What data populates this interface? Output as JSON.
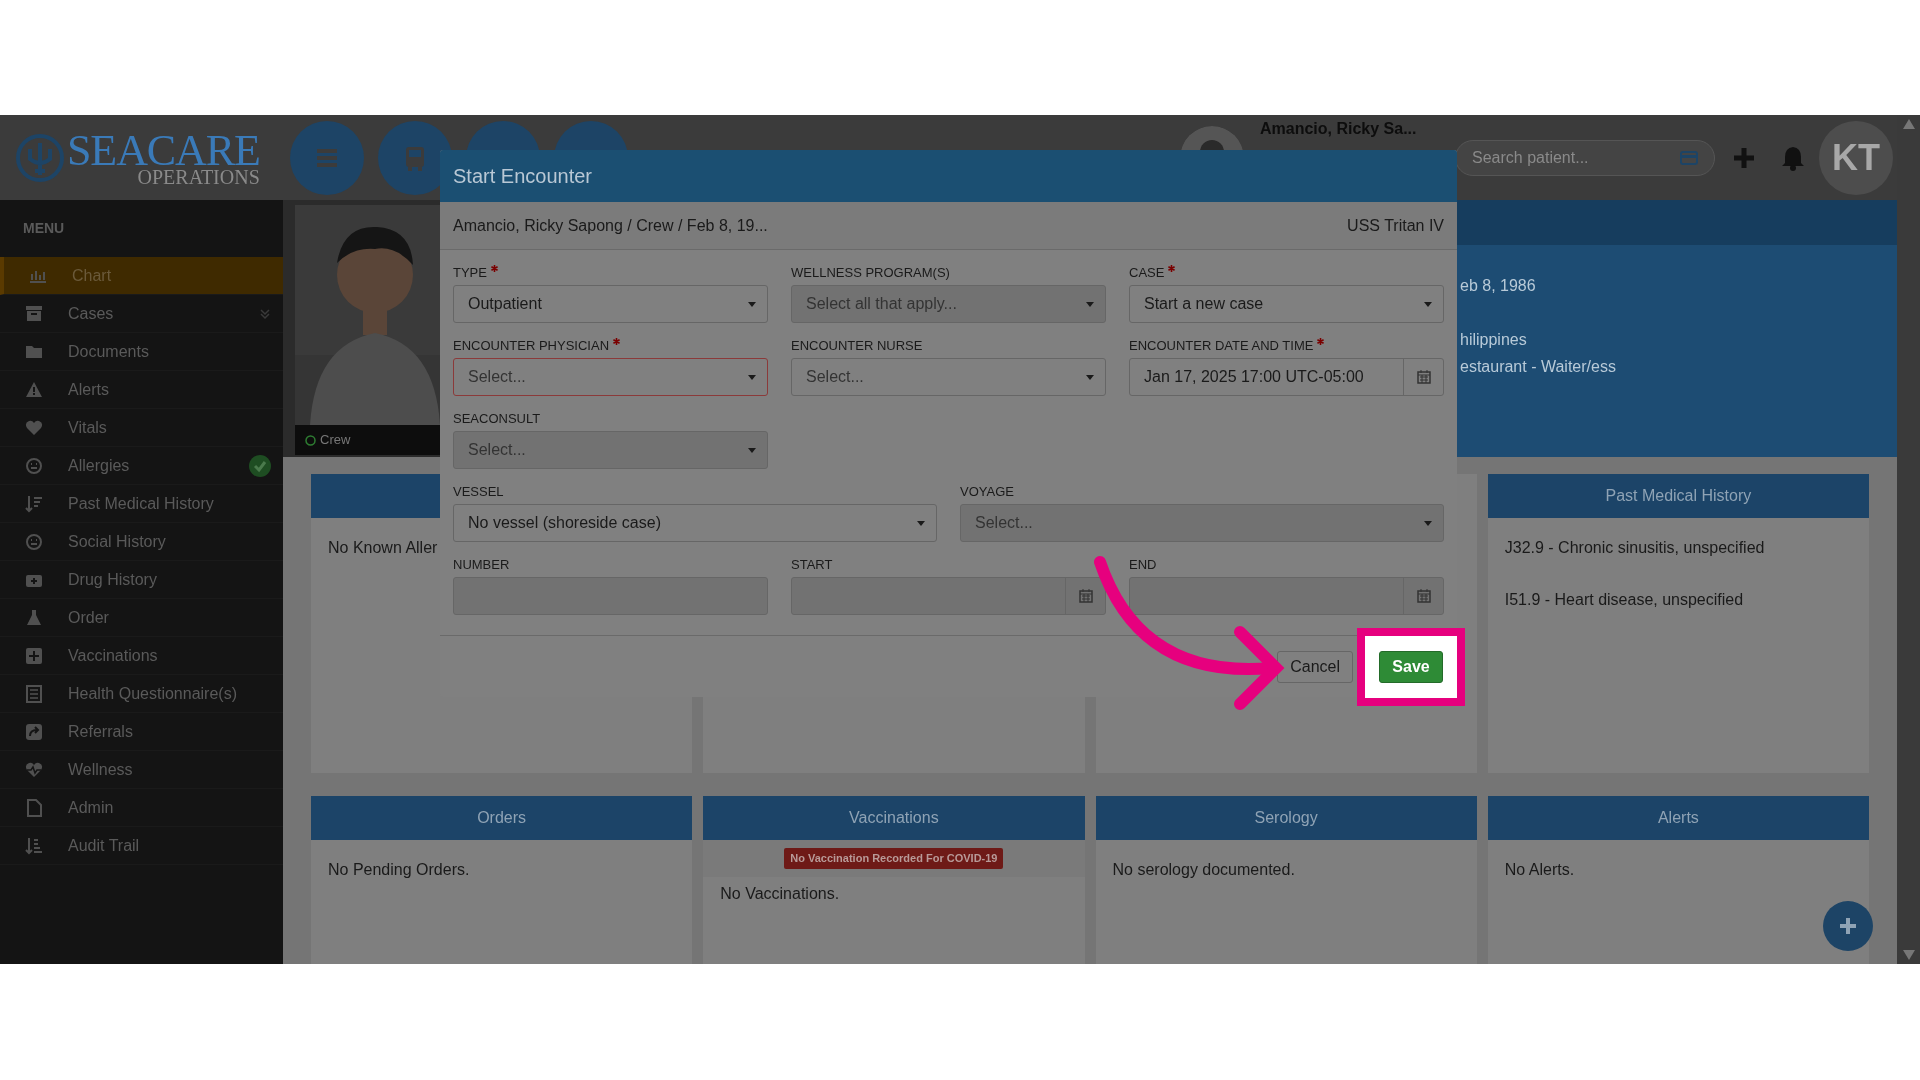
{
  "header": {
    "logo": {
      "name": "SEACARE",
      "sub": "OPERATIONS"
    },
    "patient": {
      "name": "Amancio, Ricky Sa..."
    },
    "search": {
      "placeholder": "Search patient..."
    },
    "user": {
      "initials": "KT"
    }
  },
  "sidebar": {
    "title": "MENU",
    "items": [
      {
        "label": "Chart",
        "selected": true,
        "expandable": false,
        "checked": false
      },
      {
        "label": "Cases",
        "selected": false,
        "expandable": true,
        "checked": false
      },
      {
        "label": "Documents",
        "selected": false,
        "expandable": false,
        "checked": false
      },
      {
        "label": "Alerts",
        "selected": false,
        "expandable": false,
        "checked": false
      },
      {
        "label": "Vitals",
        "selected": false,
        "expandable": false,
        "checked": false
      },
      {
        "label": "Allergies",
        "selected": false,
        "expandable": false,
        "checked": true
      },
      {
        "label": "Past Medical History",
        "selected": false,
        "expandable": false,
        "checked": false
      },
      {
        "label": "Social History",
        "selected": false,
        "expandable": false,
        "checked": false
      },
      {
        "label": "Drug History",
        "selected": false,
        "expandable": false,
        "checked": false
      },
      {
        "label": "Order",
        "selected": false,
        "expandable": false,
        "checked": false
      },
      {
        "label": "Vaccinations",
        "selected": false,
        "expandable": false,
        "checked": false
      },
      {
        "label": "Health Questionnaire(s)",
        "selected": false,
        "expandable": false,
        "checked": false
      },
      {
        "label": "Referrals",
        "selected": false,
        "expandable": false,
        "checked": false
      },
      {
        "label": "Wellness",
        "selected": false,
        "expandable": false,
        "checked": false
      },
      {
        "label": "Admin",
        "selected": false,
        "expandable": false,
        "checked": false
      },
      {
        "label": "Audit Trail",
        "selected": false,
        "expandable": false,
        "checked": false
      }
    ]
  },
  "profile": {
    "status": "Crew",
    "details": [
      "eb 8, 1986",
      "hilippines",
      "estaurant - Waiter/ess"
    ]
  },
  "top_cards": [
    {
      "lines": [
        "No Known Aller"
      ]
    },
    {
      "title": "Past Medical History",
      "lines": [
        "J32.9 - Chronic sinusitis, unspecified",
        "I51.9 - Heart disease, unspecified"
      ]
    }
  ],
  "bottom_cards": [
    {
      "title": "Orders",
      "lines": [
        "No Pending Orders."
      ]
    },
    {
      "title": "Vaccinations",
      "alert": "No Vaccination Recorded For COVID-19",
      "lines": [
        "No Vaccinations."
      ]
    },
    {
      "title": "Serology",
      "lines": [
        "No serology documented."
      ]
    },
    {
      "title": "Alerts",
      "lines": [
        "No Alerts."
      ]
    }
  ],
  "modal": {
    "title": "Start Encounter",
    "patient_line": "Amancio, Ricky Sapong / Crew / Feb 8, 19...",
    "vessel": "USS Tritan IV",
    "rows": [
      {
        "fields": [
          {
            "label": "TYPE",
            "required": true,
            "kind": "select",
            "value": "Outpatient",
            "disabled": false,
            "invalid": false
          },
          {
            "label": "WELLNESS PROGRAM(S)",
            "required": false,
            "kind": "select",
            "placeholder": "Select all that apply...",
            "disabled": true,
            "invalid": false
          },
          {
            "label": "CASE",
            "required": true,
            "kind": "select",
            "value": "Start a new case",
            "disabled": false,
            "invalid": false
          }
        ]
      },
      {
        "fields": [
          {
            "label": "ENCOUNTER PHYSICIAN",
            "required": true,
            "kind": "select",
            "placeholder": "Select...",
            "disabled": false,
            "invalid": true
          },
          {
            "label": "ENCOUNTER NURSE",
            "required": false,
            "kind": "select",
            "placeholder": "Select...",
            "disabled": false,
            "invalid": false
          },
          {
            "label": "ENCOUNTER DATE AND TIME",
            "required": true,
            "kind": "date",
            "value": "Jan 17, 2025 17:00 UTC-05:00",
            "disabled": false,
            "invalid": false
          }
        ]
      },
      {
        "fields": [
          {
            "label": "SEACONSULT",
            "required": false,
            "kind": "select",
            "placeholder": "Select...",
            "disabled": true,
            "invalid": false
          }
        ]
      },
      {
        "fields": [
          {
            "label": "VESSEL",
            "required": false,
            "kind": "select",
            "value": "No vessel (shoreside case)",
            "disabled": false,
            "invalid": false
          },
          {
            "label": "VOYAGE",
            "required": false,
            "kind": "select",
            "placeholder": "Select...",
            "disabled": true,
            "invalid": false
          }
        ]
      },
      {
        "fields": [
          {
            "label": "NUMBER",
            "required": false,
            "kind": "text",
            "disabled": true,
            "invalid": false
          },
          {
            "label": "START",
            "required": false,
            "kind": "date",
            "disabled": true,
            "invalid": false
          },
          {
            "label": "END",
            "required": false,
            "kind": "date",
            "disabled": true,
            "invalid": false
          }
        ]
      }
    ],
    "buttons": [
      {
        "label": "Cancel",
        "kind": "secondary",
        "highlighted": false
      },
      {
        "label": "Save",
        "kind": "primary",
        "highlighted": true
      }
    ]
  }
}
